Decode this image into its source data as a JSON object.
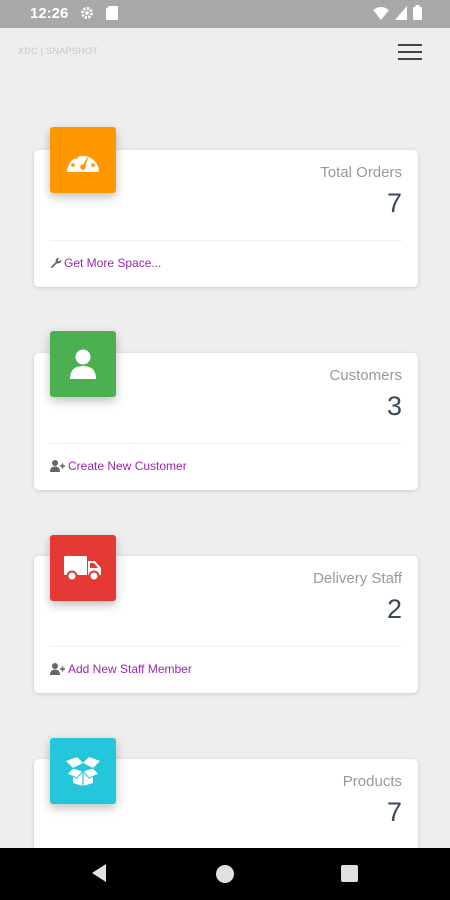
{
  "status_bar": {
    "time": "12:26",
    "icons": [
      "gear-icon",
      "sd-card-icon",
      "wifi-icon",
      "signal-icon",
      "battery-icon"
    ]
  },
  "header": {
    "title": "XDC | SNAPSHOT",
    "menu_icon": "hamburger-menu-icon"
  },
  "cards": [
    {
      "label": "Total Orders",
      "value": "7",
      "footer": "Get More Space...",
      "footer_icon": "wrench-icon",
      "icon": "speedometer-icon",
      "color": "#ff9800"
    },
    {
      "label": "Customers",
      "value": "3",
      "footer": "Create New Customer",
      "footer_icon": "add-user-icon",
      "icon": "person-icon",
      "color": "#4caf50"
    },
    {
      "label": "Delivery Staff",
      "value": "2",
      "footer": "Add New Staff Member",
      "footer_icon": "add-user-icon",
      "icon": "truck-icon",
      "color": "#e53935"
    },
    {
      "label": "Products",
      "value": "7",
      "icon": "open-box-icon",
      "color": "#26c6da"
    }
  ],
  "nav_bar": {
    "buttons": [
      "back-icon",
      "home-icon",
      "recent-apps-icon"
    ]
  }
}
